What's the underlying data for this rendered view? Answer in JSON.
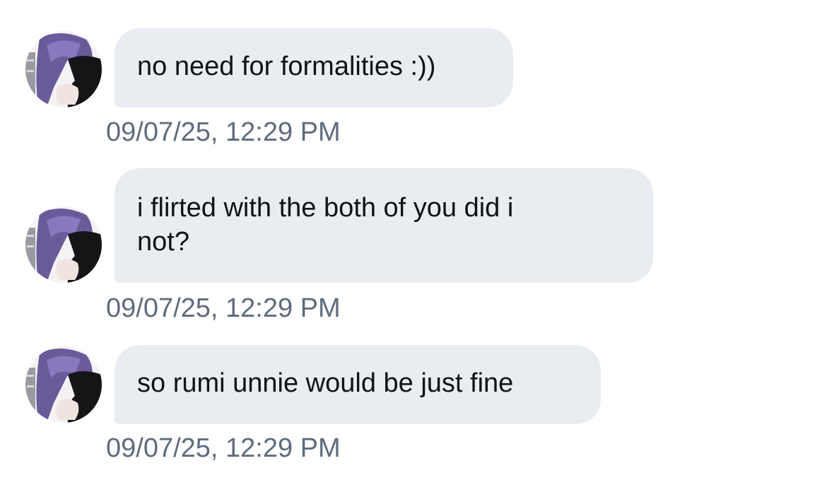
{
  "messages": [
    {
      "text": "no need for formalities :))",
      "timestamp": "09/07/25, 12:29 PM"
    },
    {
      "text": "i flirted with the both of you did i\nnot?",
      "timestamp": "09/07/25, 12:29 PM"
    },
    {
      "text": "so rumi unnie would be just fine",
      "timestamp": "09/07/25, 12:29 PM"
    }
  ],
  "colors": {
    "bubble_background": "#e9ecf0",
    "message_text": "#101418",
    "timestamp_text": "#5d6c7e",
    "avatar_hair": "#6a5a9a"
  }
}
